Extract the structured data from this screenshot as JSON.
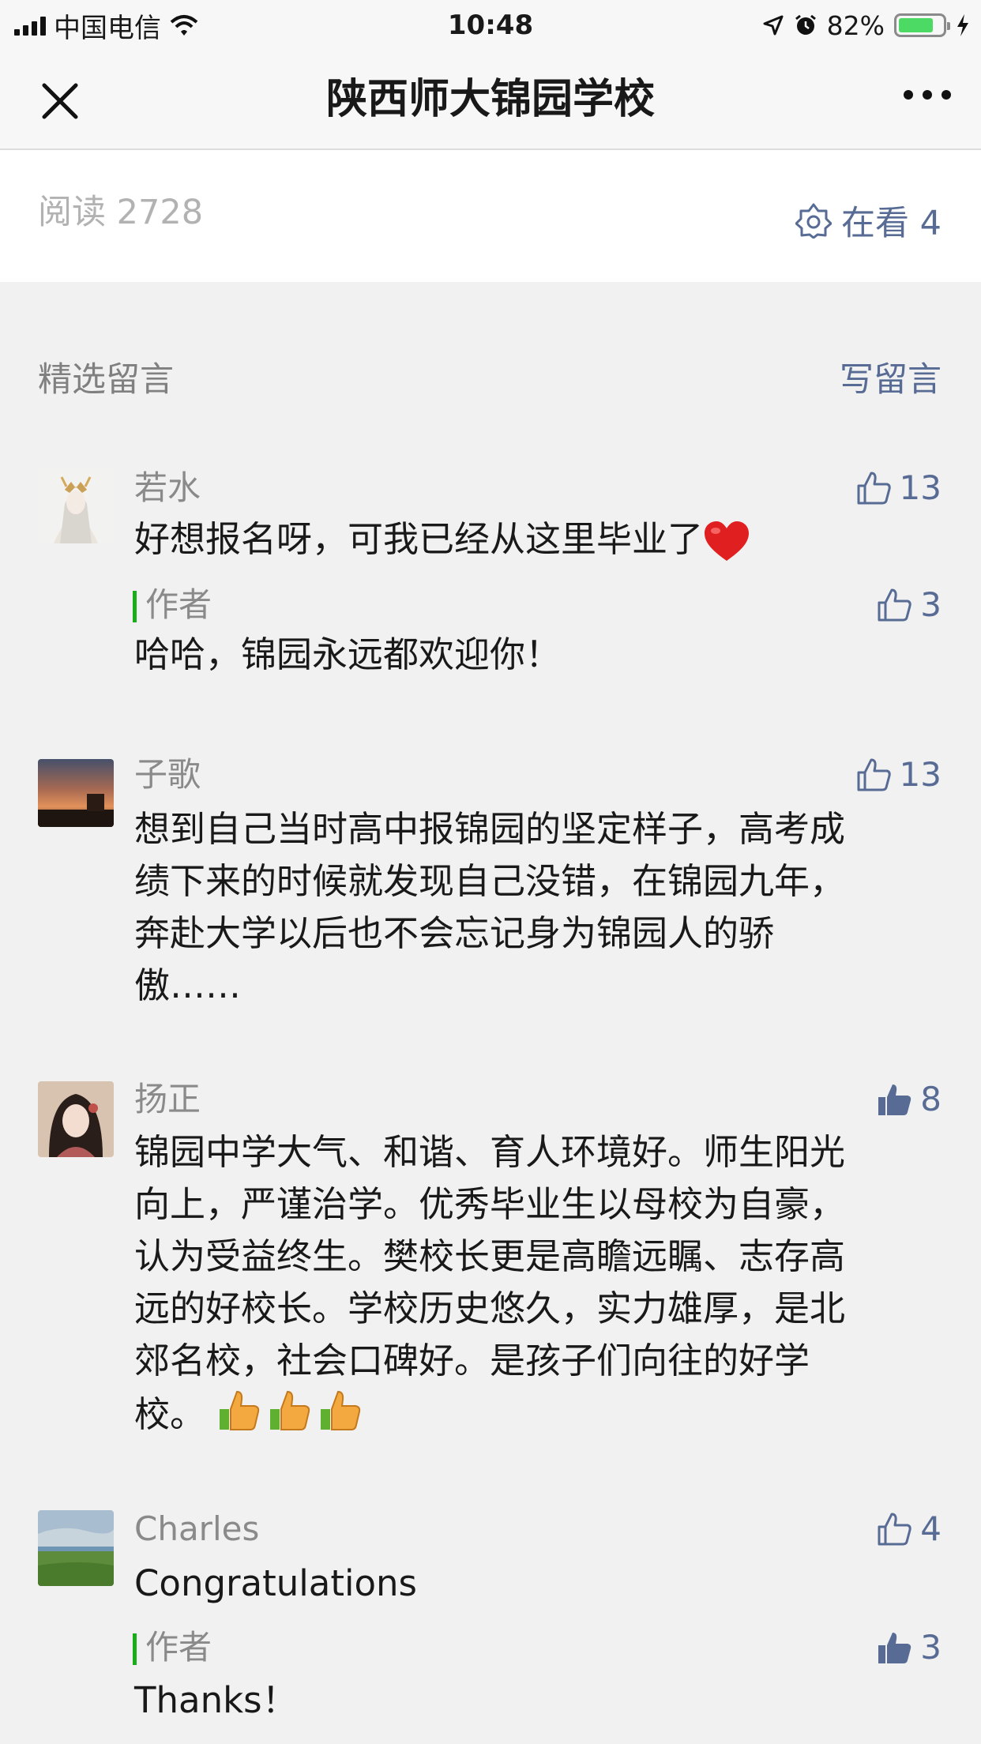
{
  "status_bar": {
    "carrier": "中国电信",
    "time": "10:48",
    "battery": "82%",
    "battery_level": 0.82
  },
  "nav": {
    "title": "陕西师大锦园学校"
  },
  "stats": {
    "read_count": "阅读 2728",
    "watching": "在看 4"
  },
  "comments_section": {
    "title": "精选留言",
    "write_label": "写留言"
  },
  "comments": [
    {
      "name": "若水",
      "likes": "13",
      "liked": false,
      "text": "好想报名呀，可我已经从这里毕业了",
      "emoji": "heart",
      "author_reply": {
        "label": "作者",
        "likes": "3",
        "liked": false,
        "text": "哈哈，锦园永远都欢迎你！"
      }
    },
    {
      "name": "子歌",
      "likes": "13",
      "liked": false,
      "text_lines": [
        "想到自己当时高中报锦园的坚定样子，高考成",
        "绩下来的时候就发现自己没错，在锦园九年，",
        "奔赴大学以后也不会忘记身为锦园人的骄",
        "傲……"
      ]
    },
    {
      "name": "扬正",
      "likes": "8",
      "liked": true,
      "text_lines": [
        "锦园中学大气、和谐、育人环境好。师生阳光",
        "向上，严谨治学。优秀毕业生以母校为自豪，",
        "认为受益终生。樊校长更是高瞻远瞩、志存高",
        "远的好校长。学校历史悠久，实力雄厚，是北",
        "郊名校，社会口碑好。是孩子们向往的好学",
        "校。"
      ]
    },
    {
      "name": "Charles",
      "likes": "4",
      "liked": false,
      "text": "Congratulations",
      "author_reply": {
        "label": "作者",
        "likes": "3",
        "liked": true,
        "text": "Thanks！"
      }
    }
  ]
}
